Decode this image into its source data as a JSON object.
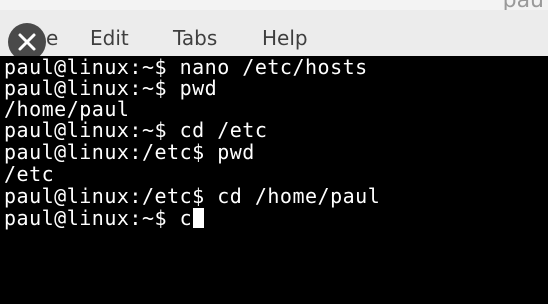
{
  "window": {
    "title": "pau"
  },
  "menubar": {
    "items": [
      {
        "label": "e"
      },
      {
        "label": "Edit"
      },
      {
        "label": "Tabs"
      },
      {
        "label": "Help"
      }
    ]
  },
  "terminal": {
    "lines": [
      "paul@linux:~$ nano /etc/hosts",
      "paul@linux:~$ pwd",
      "/home/paul",
      "paul@linux:~$ cd /etc",
      "paul@linux:/etc$ pwd",
      "/etc",
      "paul@linux:/etc$ cd /home/paul",
      "paul@linux:~$ c"
    ]
  },
  "icons": {
    "close": "close-icon",
    "cursor": "block-cursor"
  },
  "colors": {
    "terminal_bg": "#000000",
    "terminal_fg": "#ffffff",
    "menubar_bg": "#ececec",
    "close_button_bg": "#4a4a4a"
  }
}
